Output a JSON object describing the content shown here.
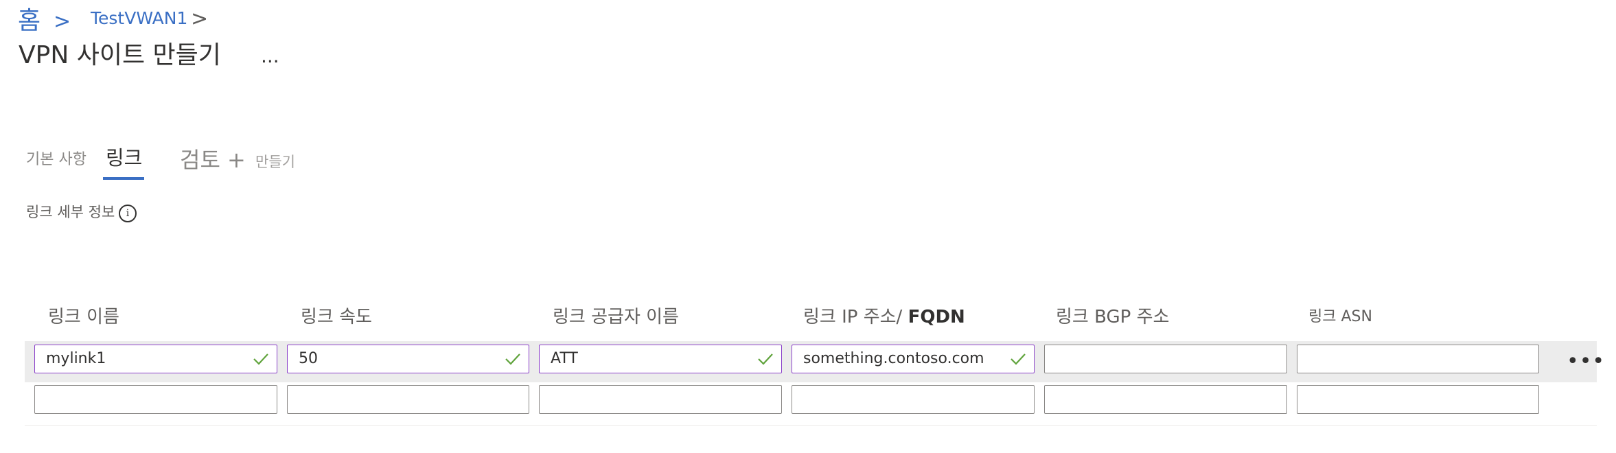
{
  "breadcrumb": {
    "home": "홈",
    "separator": ">",
    "item": "TestVWAN1",
    "trailing_chevron": ">"
  },
  "page": {
    "title": "VPN 사이트 만들기",
    "more": "..."
  },
  "tabs": {
    "basics": "기본 사항",
    "links": "링크",
    "review": "검토 +",
    "create": "만들기",
    "active": "links"
  },
  "section": {
    "label": "링크 세부 정보",
    "info_icon": "i"
  },
  "table": {
    "headers": {
      "name": "링크 이름",
      "speed": "링크 속도",
      "provider": "링크 공급자 이름",
      "ip_prefix": "링크 IP 주소/ ",
      "ip_fqdn": "FQDN",
      "bgp": "링크 BGP 주소",
      "asn": "링크 ASN"
    },
    "rows": [
      {
        "name": "mylink1",
        "speed": "50",
        "provider": "ATT",
        "ip": "something.contoso.com",
        "bgp": "",
        "asn": ""
      },
      {
        "name": "",
        "speed": "",
        "provider": "",
        "ip": "",
        "bgp": "",
        "asn": ""
      }
    ],
    "row_more": "•••"
  },
  "colors": {
    "accent": "#3a6fc4",
    "valid_border": "#8a3fc9",
    "check": "#5fa33b"
  },
  "icons": [
    "check-icon",
    "info-icon",
    "more-icon",
    "chevron-right-icon"
  ]
}
